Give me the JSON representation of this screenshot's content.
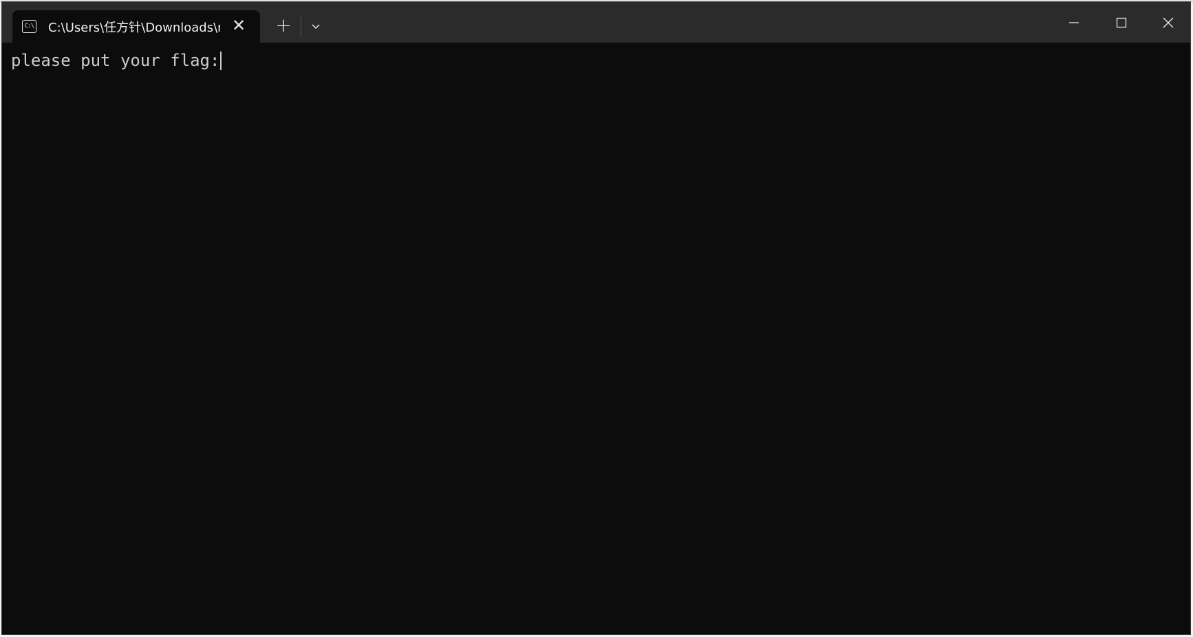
{
  "window": {
    "tab_title": "C:\\Users\\任方针\\Downloads\\re",
    "tab_icon": "cmd-icon",
    "new_tab_symbol": "+",
    "close_tab_symbol": "✕"
  },
  "terminal": {
    "prompt_text": "please put your flag:",
    "input_value": ""
  },
  "colors": {
    "titlebar": "#2b2b2b",
    "terminal_bg": "#0c0c0c",
    "text": "#cccccc"
  }
}
